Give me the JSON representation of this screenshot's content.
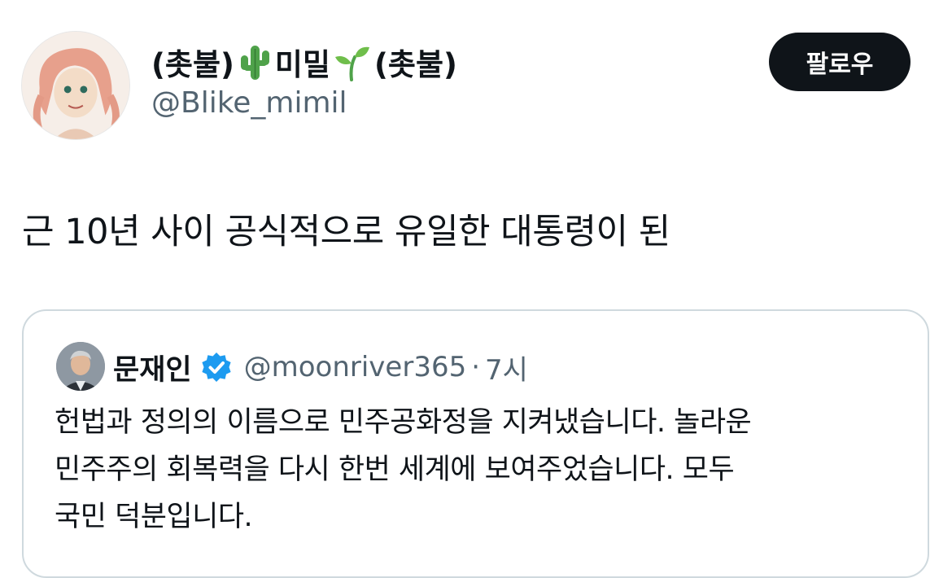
{
  "author": {
    "name_part1": "(촛불)",
    "name_emoji1": "cactus-emoji",
    "name_part2": "미밀",
    "name_emoji2": "seedling-emoji",
    "name_part3": "(촛불)",
    "handle": "@Blike_mimil",
    "avatar": "avatar-illustration"
  },
  "follow_button": {
    "label": "팔로우"
  },
  "tweet": {
    "text": "근 10년 사이 공식적으로 유일한 대통령이 된"
  },
  "quoted_tweet": {
    "name": "문재인",
    "verified_icon": "verified-badge-icon",
    "handle": "@moonriver365",
    "separator": "·",
    "time": "7시",
    "text_lines": [
      "헌법과 정의의 이름으로 민주공화정을 지켜냈습니다. 놀라운",
      "민주주의 회복력을 다시 한번 세계에 보여주었습니다. 모두",
      "국민 덕분입니다."
    ]
  },
  "colors": {
    "text_primary": "#0f1419",
    "text_secondary": "#536471",
    "border": "#cfd9de",
    "button_bg": "#0f1419",
    "verified_blue": "#1d9bf0"
  }
}
